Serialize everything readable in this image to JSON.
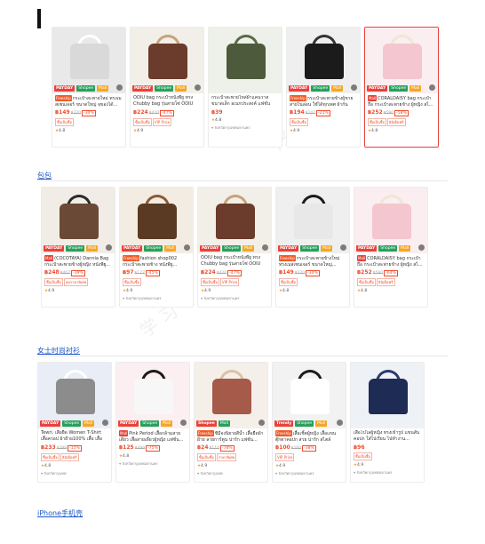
{
  "sections": [
    {
      "link": "",
      "cards": [
        {
          "badges": [
            "PAYDAY",
            "Shopee",
            "Mall"
          ],
          "tag": "Freeship",
          "title": "กระเป๋าสะพายใหม่ ทรงเมสเซนเจอร์ ขนาดใหญ่ จุของได้...",
          "price": "฿149",
          "old": "฿320",
          "disc": "-34%",
          "chips": [
            "ซื้อเป็นซื้อ"
          ],
          "rating": "4.8",
          "loc": "",
          "hl": false
        },
        {
          "badges": [
            "PAYDAY",
            "Shopee",
            "Mall"
          ],
          "tag": "",
          "title": "OOIU bag กระเป๋าหนังพียู ทรง Chubby bag รุ่นสายโซ่ OOIU",
          "price": "฿224",
          "old": "฿420",
          "disc": "-47%",
          "chips": [
            "ซื้อเป็นซื้อ",
            "VIP Price"
          ],
          "rating": "4.9",
          "loc": "",
          "hl": false
        },
        {
          "badges": [],
          "tag": "",
          "title": "กระเป๋าสะพายไหล่ผ้าแคนวาส ขนาดเล็ก อเนกประสงค์ แฟชั่นสำหรับ...",
          "price": "฿39",
          "old": "",
          "disc": "",
          "chips": [],
          "rating": "4.8",
          "loc": "จังหวัดกรุงเทพมหานคร",
          "hl": false
        },
        {
          "badges": [
            "PAYDAY",
            "Shopee",
            "Mall"
          ],
          "tag": "Freeship",
          "title": "กระเป๋าสะพายข้างผู้ชาย สายไนล่อน ใช้ได้ทุกเพศ ผ้ากันน้ำ...",
          "price": "฿194",
          "old": "฿247",
          "disc": "-21%",
          "chips": [
            "ซื้อเป็นซื้อ"
          ],
          "rating": "4.9",
          "loc": "",
          "hl": false
        },
        {
          "badges": [
            "PAYDAY",
            "Shopee",
            "Mall"
          ],
          "tag": "Mall",
          "title": "CORALDAISY bag กระเป๋าถือ กระเป๋าสะพายข้าง ผู้หญิง สไ...",
          "price": "฿252",
          "old": "฿590",
          "disc": "-58%",
          "chips": [
            "ซื้อเป็นซื้อ",
            "ลิมิเต็ดฟรี"
          ],
          "rating": "4.8",
          "loc": "",
          "hl": true
        }
      ]
    },
    {
      "link": "包包",
      "cards": [
        {
          "badges": [
            "PAYDAY",
            "Shopee",
            "Mall"
          ],
          "tag": "Mall",
          "title": "(COCOTAYA) Dannia Bag กระเป๋าสะพายข้างผู้หญิง หนังพียู...",
          "price": "฿248",
          "old": "฿407",
          "disc": "-39%",
          "chips": [
            "ซื้อเป็นซื้อ",
            "ลดราคาพิเศษ"
          ],
          "rating": "4.9",
          "loc": "",
          "hl": false
        },
        {
          "badges": [
            "PAYDAY",
            "Shopee",
            "Mall"
          ],
          "tag": "Freeship",
          "title": "fashion shop002 กระเป๋าสะพายข้าง หนังพียู...",
          "price": "฿97",
          "old": "฿177",
          "disc": "-45%",
          "chips": [
            "ซื้อเป็นซื้อ"
          ],
          "rating": "4.9",
          "loc": "จังหวัดกรุงเทพมหานคร",
          "hl": false
        },
        {
          "badges": [
            "PAYDAY",
            "Shopee",
            "Mall"
          ],
          "tag": "",
          "title": "OOIU bag กระเป๋าหนังพียู ทรง Chubby bag รุ่นสายโซ่ OOIU",
          "price": "฿224",
          "old": "฿420",
          "disc": "-47%",
          "chips": [
            "ซื้อเป็นซื้อ",
            "VIP Price"
          ],
          "rating": "4.9",
          "loc": "จังหวัดกรุงเทพมหานคร",
          "hl": false
        },
        {
          "badges": [
            "PAYDAY",
            "Shopee",
            "Mall"
          ],
          "tag": "Freeship",
          "title": "กระเป๋าสะพายข้างใหม่ ทรงเมสเซนเจอร์ ขนาดใหญ่...",
          "price": "฿149",
          "old": "฿320",
          "disc": "-34%",
          "chips": [
            "ซื้อเป็นซื้อ"
          ],
          "rating": "4.8",
          "loc": "",
          "hl": false
        },
        {
          "badges": [
            "PAYDAY",
            "Shopee",
            "Mall"
          ],
          "tag": "Mall",
          "title": "CORALDAISY bag กระเป๋าถือ กระเป๋าสะพายข้าง ผู้หญิง สไ...",
          "price": "฿252",
          "old": "฿590",
          "disc": "-64%",
          "chips": [
            "ซื้อเป็นซื้อ",
            "ลิมิเต็ดฟรี"
          ],
          "rating": "4.8",
          "loc": "",
          "hl": false
        }
      ]
    },
    {
      "link": "女士时尚衬衫",
      "cards": [
        {
          "badges": [
            "PAYDAY",
            "Shopee",
            "Mall"
          ],
          "tag": "",
          "title": "Tewri. เสื้อยืด Women T-Shirt เสื้อครอป ผ้าฝ้าย100% เสื้อ เสื้อยืด...",
          "price": "฿233",
          "old": "฿299",
          "disc": "-15%",
          "chips": [
            "ซื้อเป็นซื้อ",
            "ลิมิเต็ดฟรี"
          ],
          "rating": "4.8",
          "loc": "จังหวัดกรุงเทพ",
          "hl": false
        },
        {
          "badges": [
            "PAYDAY",
            "Shopee",
            "Mall"
          ],
          "tag": "Mall",
          "title": "Pink Period เสื้อกล้ามสายเดี่ยว เสื้อสายเดี่ยวผู้หญิง แฟชั่น...",
          "price": "฿125",
          "old": "฿499",
          "disc": "-75%",
          "chips": [],
          "rating": "4.8",
          "loc": "จังหวัดกรุงเทพมหานคร",
          "hl": false
        },
        {
          "badges": [
            "Shopee",
            "Mall"
          ],
          "tag": "Freeship",
          "title": "ชีมีจงนิยายสีน้ำ เสื้อยืดผ้าฝ้าย ลายการ์ตูน น่ารัก แฟชั่น...",
          "price": "฿24",
          "old": "฿110",
          "disc": "-78%",
          "chips": [
            "ซื้อเป็นซื้อ",
            "ราคาพิเศษ"
          ],
          "rating": "4.9",
          "loc": "จังหวัดกรุงเทพ",
          "hl": false
        },
        {
          "badges": [
            "Trendy",
            "Shopee",
            "Mall"
          ],
          "tag": "Freeship",
          "title": "เสื้อเชิ้ตผู้หญิง เสื้อแขนตุ๊กตาคอปก สวย น่ารัก สไตล์เกาหลี...",
          "price": "฿100",
          "old": "฿160",
          "disc": "-38%",
          "chips": [
            "VIP Price"
          ],
          "rating": "4.9",
          "loc": "จังหวัดกรุงเทพมหานคร",
          "hl": false
        },
        {
          "badges": [],
          "tag": "",
          "title": "เสื้อโปโลผู้หญิง ทรงเข้ารูป แขนสั้น คอปก ใส่ไปเรียน ไปทำงาน...",
          "price": "฿96",
          "old": "",
          "disc": "",
          "chips": [
            "ซื้อเป็นซื้อ"
          ],
          "rating": "4.9",
          "loc": "จังหวัดกรุงเทพมหานคร",
          "hl": false
        }
      ]
    }
  ],
  "footer_link": "iPhone手机壳",
  "colors": {
    "accent": "#ee4d2d",
    "link": "#1a56c7",
    "highlight_border": "#e8423a"
  }
}
